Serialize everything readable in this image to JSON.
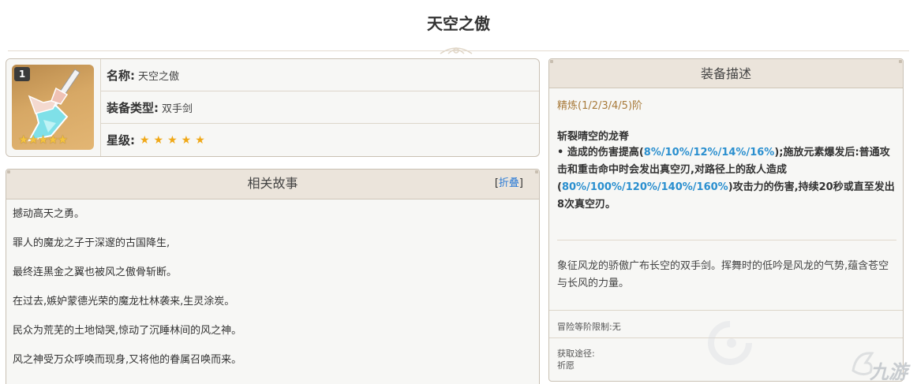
{
  "page": {
    "title": "天空之傲"
  },
  "weapon": {
    "refine_badge": "1",
    "name_label": "名称:",
    "name_value": "天空之傲",
    "type_label": "装备类型:",
    "type_value": "双手剑",
    "rarity_label": "星级:",
    "rarity_stars": "★★★★★",
    "thumb_stars": "★★★★★"
  },
  "story": {
    "header": "相关故事",
    "collapse_open": "[",
    "collapse_link": "折叠",
    "collapse_close": "]",
    "lines": [
      "撼动高天之勇。",
      "罪人的魔龙之子于深邃的古国降生,",
      "最终连黑金之翼也被风之傲骨斩断。",
      "在过去,嫉妒蒙德光荣的魔龙杜林袭来,生灵涂炭。",
      "民众为荒芜的土地恸哭,惊动了沉睡林间的风之神。",
      "风之神受万众呼唤而现身,又将他的眷属召唤而来。"
    ]
  },
  "description": {
    "header": "装备描述",
    "refine": "精炼(1/2/3/4/5)阶",
    "passive_name": "斩裂晴空的龙脊",
    "passive_parts": [
      "• 造成的伤害提高(",
      "8%/10%/12%/14%/16%",
      ");施放元素爆发后:普通攻击和重击命中时会发出真空刃,对路径上的敌人造成(",
      "80%/100%/120%/140%/160%",
      ")攻击力的伤害,持续20秒或直至发出8次真空刃。"
    ],
    "lore": "象征风龙的骄傲广布长空的双手剑。挥舞时的低吟是风龙的气势,蕴含苍空与长风的力量。",
    "limit": "冒险等阶限制:无",
    "source_label": "获取途径:",
    "source_value": "祈愿"
  },
  "watermark": {
    "text": "九游"
  },
  "colors": {
    "accent_link": "#2a7ad6",
    "highlight": "#2a8fcf",
    "refine": "#a87a3a",
    "star": "#f0a817"
  }
}
